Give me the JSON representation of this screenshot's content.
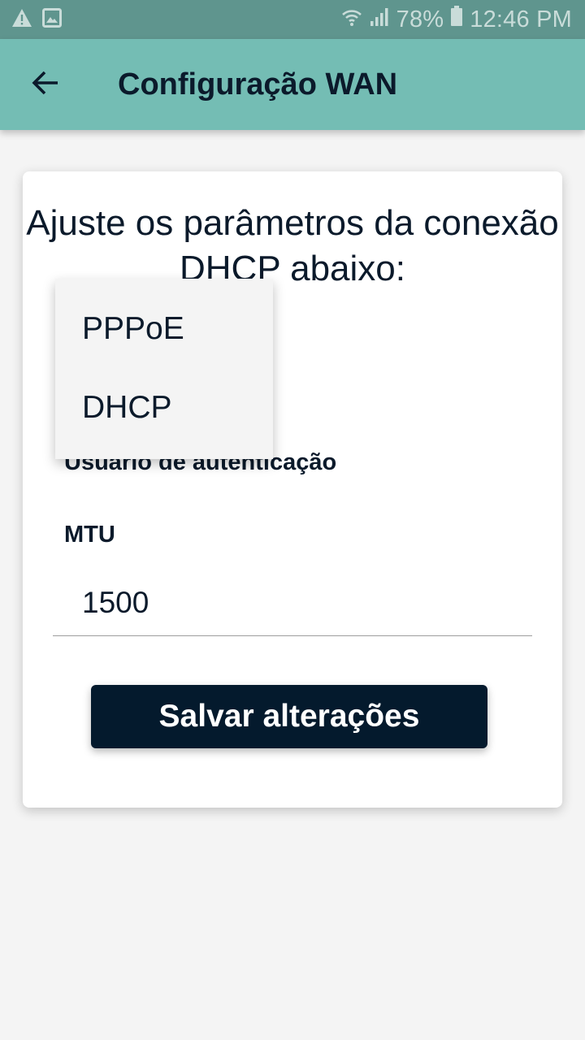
{
  "status_bar": {
    "battery": "78%",
    "time": "12:46 PM"
  },
  "app_bar": {
    "title": "Configuração WAN"
  },
  "card": {
    "heading": "Ajuste os parâmetros da conexão DHCP abaixo:",
    "user_label": "Usuário de autenticação",
    "mtu_label": "MTU",
    "mtu_value": "1500",
    "save_label": "Salvar alterações"
  },
  "dropdown": {
    "options": [
      "PPPoE",
      "DHCP"
    ]
  },
  "colors": {
    "status_bar": "#5f958e",
    "app_bar": "#74bdb4",
    "button": "#041a2d",
    "text": "#0b1a2b"
  },
  "icons": {
    "warning": "warning-icon",
    "image": "image-icon",
    "wifi": "wifi-icon",
    "signal": "signal-icon",
    "battery": "battery-icon",
    "back": "back-arrow-icon"
  }
}
